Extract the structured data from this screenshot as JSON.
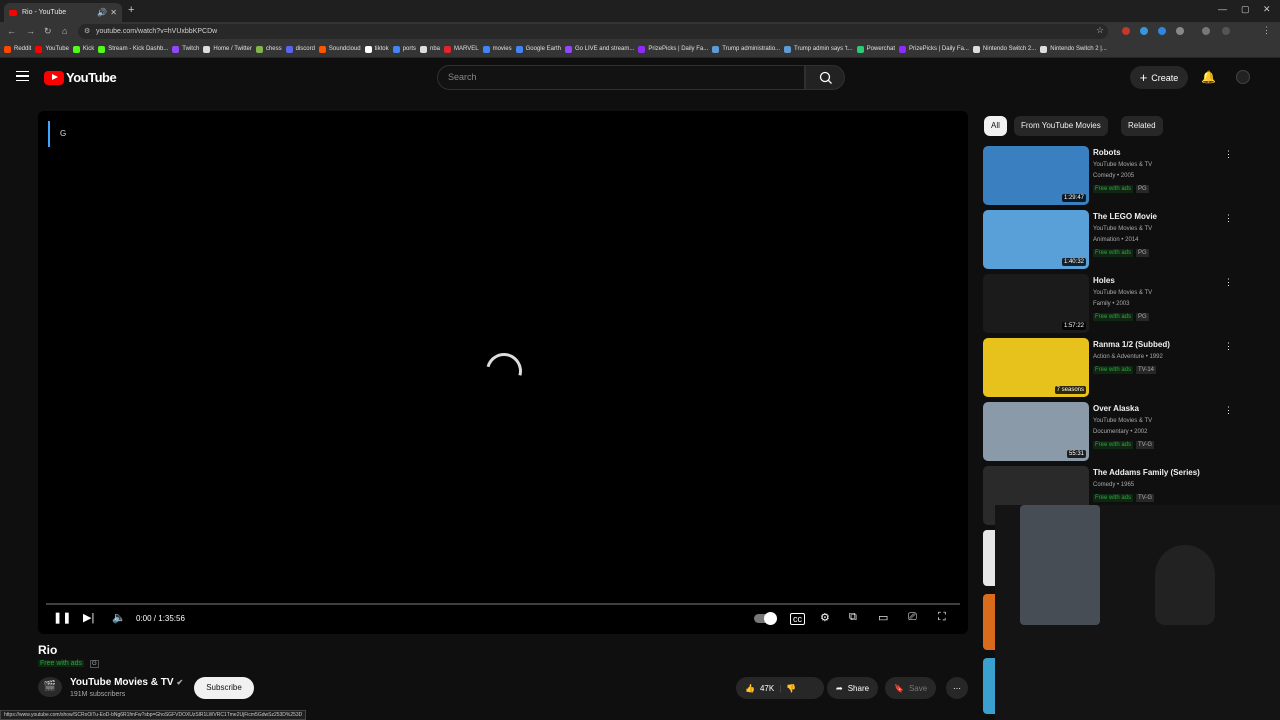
{
  "browser": {
    "tab_title": "Rio - YouTube",
    "url": "youtube.com/watch?v=hVUxbbKPCDw",
    "bookmarks": [
      {
        "label": "Reddit",
        "color": "#ff4500"
      },
      {
        "label": "YouTube",
        "color": "#ff0000"
      },
      {
        "label": "Kick",
        "color": "#53fc18"
      },
      {
        "label": "Stream - Kick Dashb...",
        "color": "#53fc18"
      },
      {
        "label": "Twitch",
        "color": "#9146ff"
      },
      {
        "label": "Home / Twitter",
        "color": "#dddddd"
      },
      {
        "label": "chess",
        "color": "#81b64c"
      },
      {
        "label": "discord",
        "color": "#5865f2"
      },
      {
        "label": "Soundcloud",
        "color": "#ff5500"
      },
      {
        "label": "tiktok",
        "color": "#ffffff"
      },
      {
        "label": "ports",
        "color": "#4285f4"
      },
      {
        "label": "nba",
        "color": "#dddddd"
      },
      {
        "label": "MARVEL",
        "color": "#e62429"
      },
      {
        "label": "movies",
        "color": "#4285f4"
      },
      {
        "label": "Google Earth",
        "color": "#4285f4"
      },
      {
        "label": "Go LIVE and stream...",
        "color": "#9146ff"
      },
      {
        "label": "PrizePicks | Daily Fa...",
        "color": "#8f2bff"
      },
      {
        "label": "Trump administratio...",
        "color": "#5c9bd6"
      },
      {
        "label": "Trump admin says 't...",
        "color": "#5c9bd6"
      },
      {
        "label": "Powerchat",
        "color": "#2ecc71"
      },
      {
        "label": "PrizePicks | Daily Fa...",
        "color": "#8f2bff"
      },
      {
        "label": "Nintendo Switch 2...",
        "color": "#dddddd"
      },
      {
        "label": "Nintendo Switch 2 |...",
        "color": "#dddddd"
      }
    ],
    "status_url": "https://www.youtube.com/show/SCRoOiTu-EoD-bNg6R1fmFw?sbp=GhoSGFVDOXUzSlR1LWVRC1Tme2UjFicm5GdwSz253D%253D"
  },
  "header": {
    "logo_text": "YouTube",
    "search_placeholder": "Search",
    "create_label": "Create"
  },
  "player": {
    "caption_letter": "G",
    "time": "0:00 / 1:35:56",
    "progress_fraction": 0
  },
  "video": {
    "title": "Rio",
    "free_label": "Free with ads",
    "rating": "G",
    "channel": "YouTube Movies & TV",
    "subscribers": "191M subscribers",
    "subscribe_label": "Subscribe",
    "likes": "47K",
    "share_label": "Share",
    "save_label": "Save"
  },
  "chips": [
    "All",
    "From YouTube Movies",
    "Related"
  ],
  "recommendations": [
    {
      "title": "Robots",
      "line1": "YouTube Movies & TV",
      "line2": "Comedy • 2005",
      "free": "Free with ads",
      "rating": "PG",
      "duration": "1:29:47",
      "thumb_color": "#3a7fc0"
    },
    {
      "title": "The LEGO Movie",
      "line1": "YouTube Movies & TV",
      "line2": "Animation • 2014",
      "free": "Free with ads",
      "rating": "PG",
      "duration": "1:40:32",
      "thumb_color": "#5aa0d8"
    },
    {
      "title": "Holes",
      "line1": "YouTube Movies & TV",
      "line2": "Family • 2003",
      "free": "Free with ads",
      "rating": "PG",
      "duration": "1:57:22",
      "thumb_color": "#1b1b1b"
    },
    {
      "title": "Ranma 1/2 (Subbed)",
      "line1": "Action & Adventure • 1992",
      "line2": "",
      "free": "Free with ads",
      "rating": "TV-14",
      "duration": "7 seasons",
      "thumb_color": "#e8c21c"
    },
    {
      "title": "Over Alaska",
      "line1": "YouTube Movies & TV",
      "line2": "Documentary • 2002",
      "free": "Free with ads",
      "rating": "TV-G",
      "duration": "55:31",
      "thumb_color": "#8a9aa8"
    },
    {
      "title": "The Addams Family (Series)",
      "line1": "Comedy • 1965",
      "line2": "",
      "free": "Free with ads",
      "rating": "TV-G",
      "duration": "",
      "thumb_color": "#2a2a2a"
    }
  ]
}
